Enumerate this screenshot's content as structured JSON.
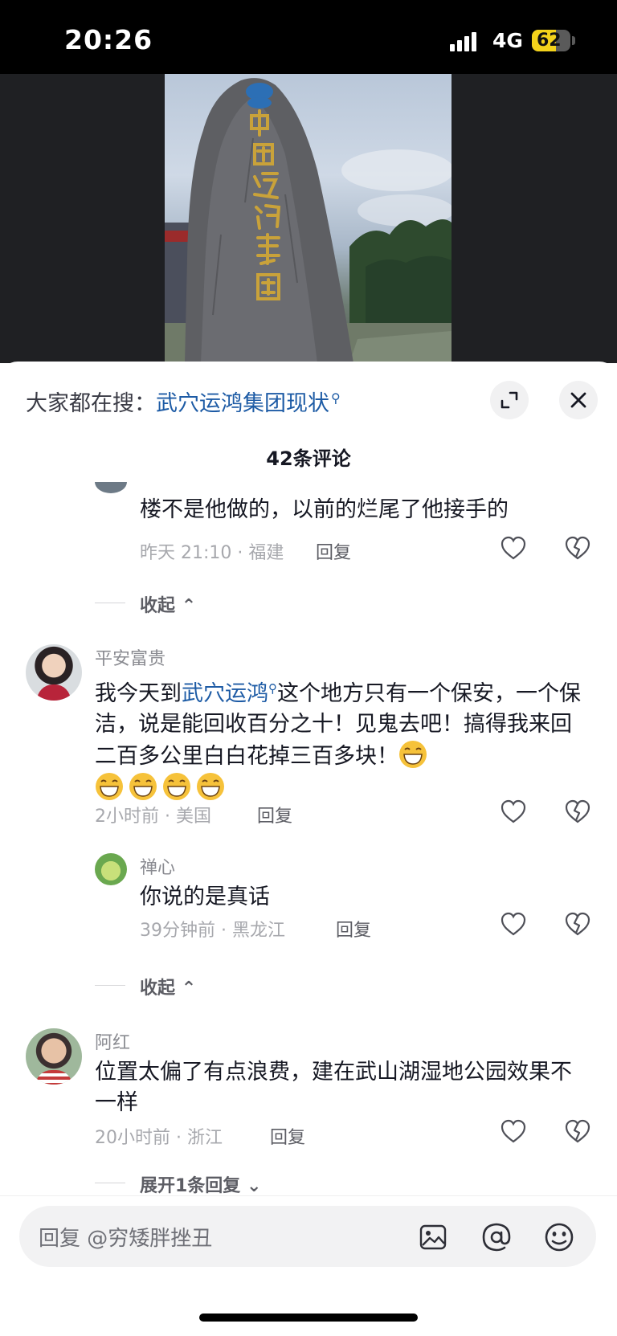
{
  "status_bar": {
    "time": "20:26",
    "network": "4G",
    "battery": "62",
    "battery_level": 0.62
  },
  "sheet": {
    "search_prefix": "大家都在搜：",
    "search_term": "武穴运鸿集团现状",
    "comment_count_title": "42条评论"
  },
  "comments": [
    {
      "name": "",
      "text": "楼不是他做的，以前的烂尾了他接手的",
      "meta": "昨天 21:10 · 福建",
      "reply_label": "回复"
    },
    {
      "collapse_label": "收起"
    },
    {
      "name": "平安富贵",
      "text_before": "我今天到",
      "link": "武穴运鸿",
      "text_after": "这个地方只有一个保安，一个保洁，说是能回收百分之十！见鬼去吧！搞得我来回二百多公里白白花掉三百多块！",
      "meta": "2小时前 · 美国",
      "reply_label": "回复"
    },
    {
      "name": "禅心",
      "text": "你说的是真话",
      "meta": "39分钟前 · 黑龙江",
      "reply_label": "回复"
    },
    {
      "collapse_label": "收起"
    },
    {
      "name": "阿红",
      "text": "位置太偏了有点浪费，建在武山湖湿地公园效果不一样",
      "meta": "20小时前 · 浙江",
      "reply_label": "回复"
    },
    {
      "expand_label": "展开1条回复"
    }
  ],
  "input": {
    "placeholder": "回复 @穷矮胖挫丑"
  },
  "icons": {
    "expand": "expand-icon",
    "close": "close-icon",
    "like": "heart-icon",
    "dislike": "broken-heart-icon",
    "image": "image-icon",
    "mention": "at-icon",
    "emoji": "emoji-icon"
  }
}
